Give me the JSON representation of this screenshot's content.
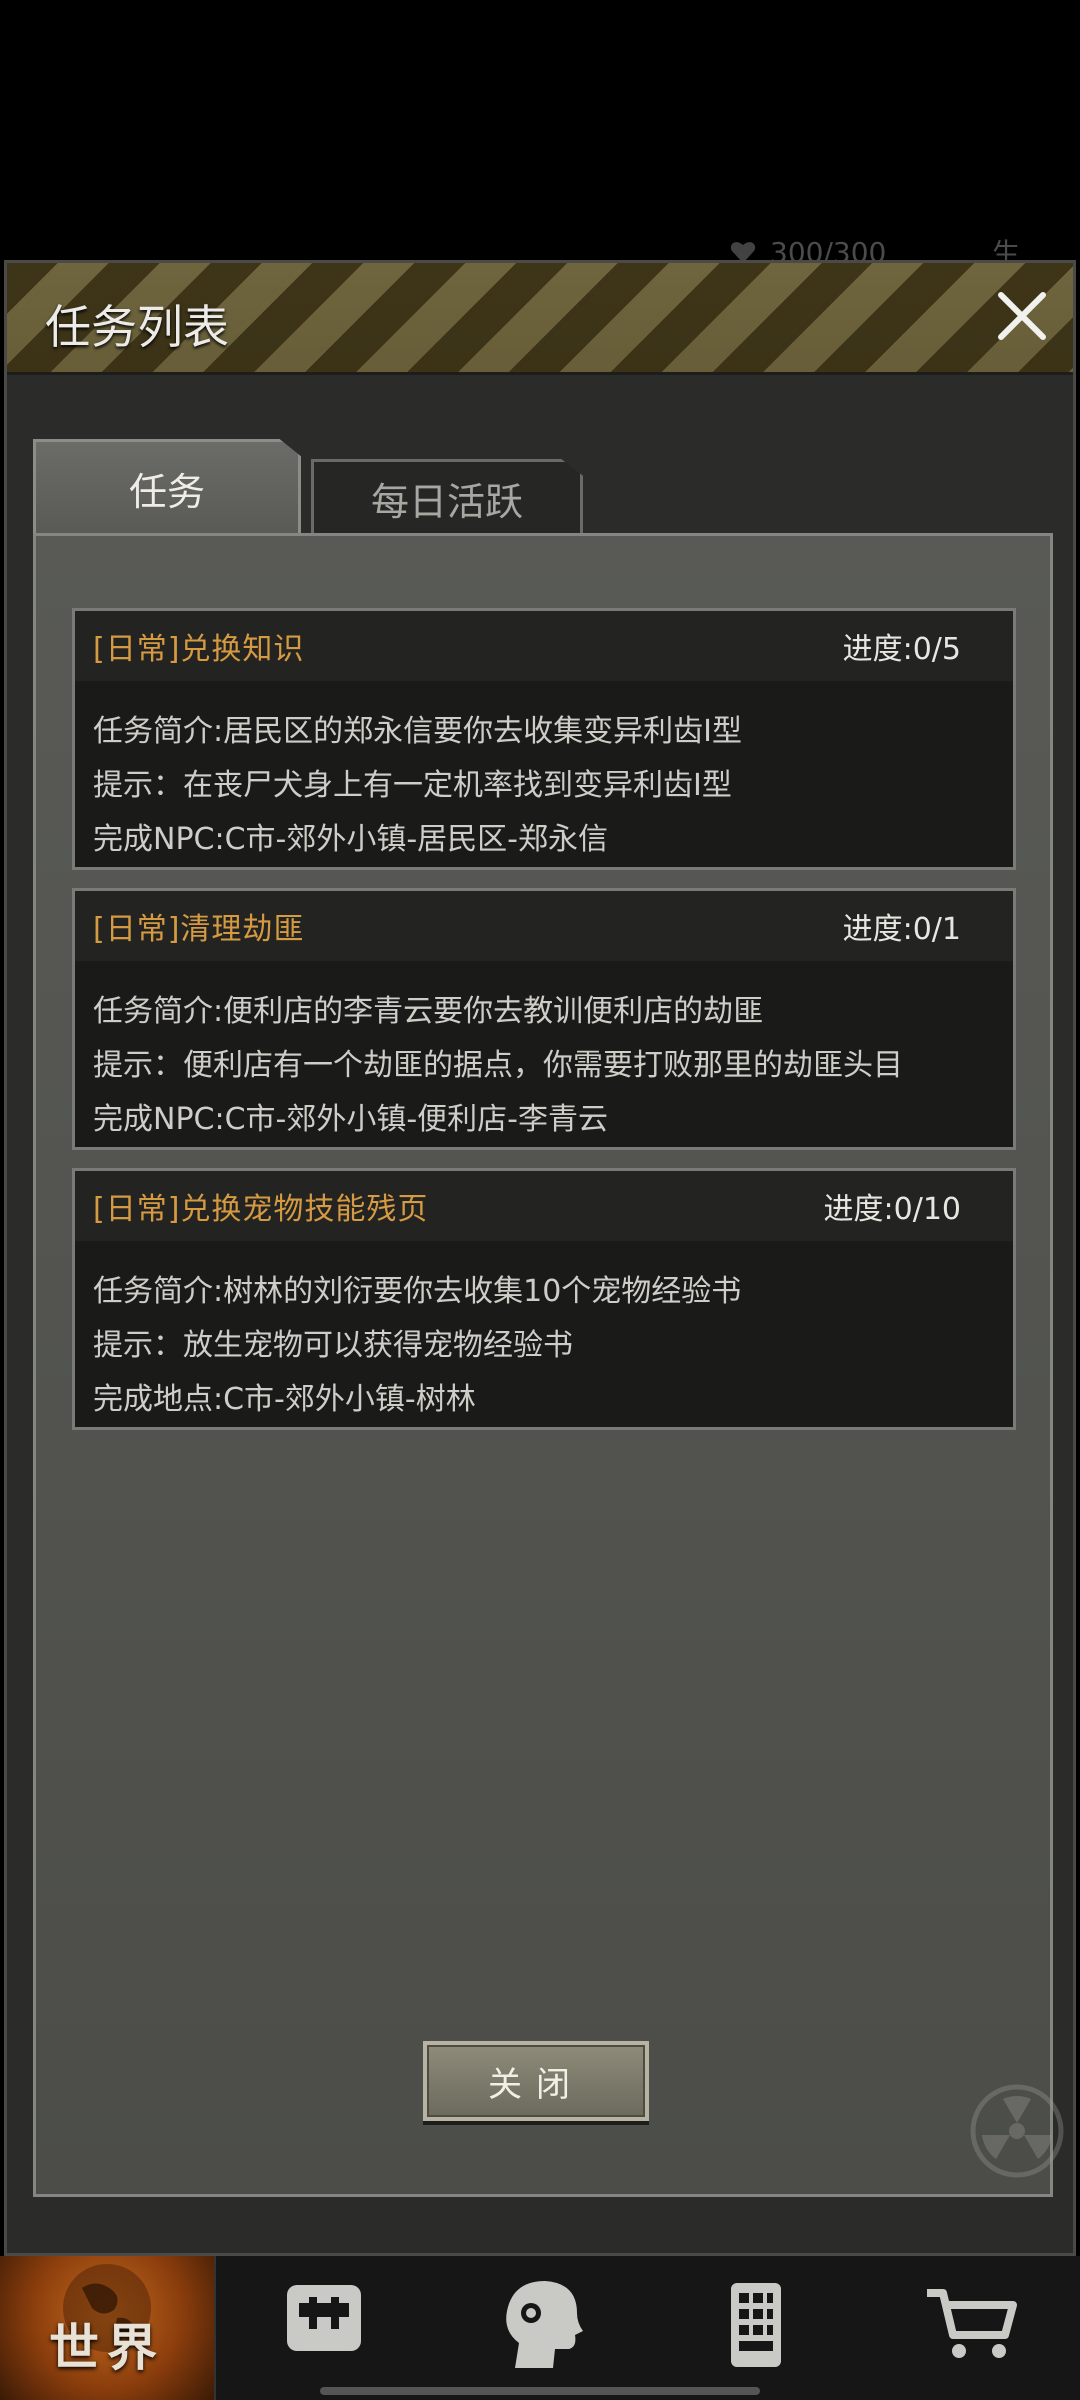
{
  "background": {
    "hp_text": "300/300",
    "life_text": "生命"
  },
  "dialog": {
    "title": "任务列表",
    "tabs": [
      {
        "label": "任务",
        "active": true
      },
      {
        "label": "每日活跃",
        "active": false
      }
    ],
    "quests": [
      {
        "title": "[日常]兑换知识",
        "progress": "进度:0/5",
        "lines": [
          "任务简介:居民区的郑永信要你去收集变异利齿Ⅰ型",
          "提示：在丧尸犬身上有一定机率找到变异利齿Ⅰ型",
          "完成NPC:C市-郊外小镇-居民区-郑永信"
        ]
      },
      {
        "title": "[日常]清理劫匪",
        "progress": "进度:0/1",
        "lines": [
          "任务简介:便利店的李青云要你去教训便利店的劫匪",
          "提示：便利店有一个劫匪的据点，你需要打败那里的劫匪头目",
          "完成NPC:C市-郊外小镇-便利店-李青云"
        ]
      },
      {
        "title": "[日常]兑换宠物技能残页",
        "progress": "进度:0/10",
        "lines": [
          "任务简介:树林的刘衍要你去收集10个宠物经验书",
          "提示：放生宠物可以获得宠物经验书",
          "完成地点:C市-郊外小镇-树林"
        ]
      }
    ],
    "close_button": "关闭"
  },
  "bottom_nav": {
    "items": [
      {
        "label": "世界",
        "icon": "globe-icon",
        "active": true
      },
      {
        "label": "",
        "icon": "backpack-icon",
        "active": false
      },
      {
        "label": "",
        "icon": "head-gear-icon",
        "active": false
      },
      {
        "label": "",
        "icon": "phone-icon",
        "active": false
      },
      {
        "label": "",
        "icon": "cart-icon",
        "active": false
      }
    ]
  },
  "colors": {
    "quest_title": "#d59a42",
    "panel": "#555652",
    "card": "#1a1b19"
  }
}
